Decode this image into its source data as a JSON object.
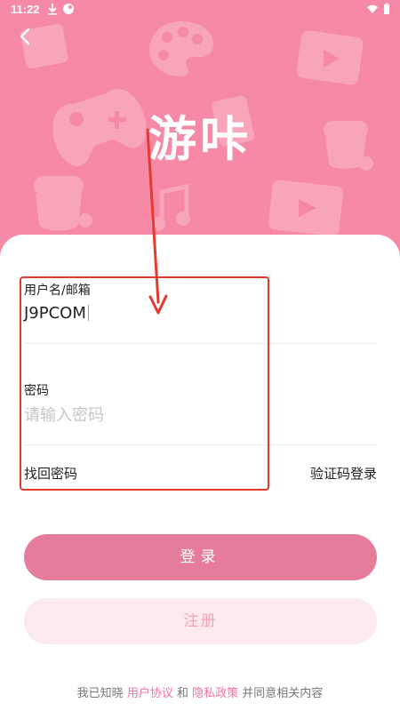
{
  "status_bar": {
    "time": "11:22",
    "icons": [
      "download-icon",
      "app-notification-icon",
      "wifi-icon",
      "battery-icon"
    ]
  },
  "header": {
    "back_icon": "chevron-left-icon",
    "app_title": "游咔",
    "background_color": "#f68aa6",
    "decorations": [
      "game-controller-icon",
      "palette-icon",
      "music-note-icon",
      "video-player-icon",
      "acorn-icon",
      "photo-card-icon"
    ]
  },
  "form": {
    "username_label": "用户名/邮箱",
    "username_value": "J9PCOM",
    "password_label": "密码",
    "password_placeholder": "请输入密码",
    "forgot_password": "找回密码",
    "sms_login": "验证码登录"
  },
  "buttons": {
    "login": "登录",
    "register": "注册"
  },
  "footer": {
    "prefix": "我已知晓",
    "user_agreement": "用户协议",
    "and": "和",
    "privacy_policy": "隐私政策",
    "suffix": "并同意相关内容"
  },
  "colors": {
    "accent": "#f3739a",
    "login_button": "#e57c99",
    "register_button_bg": "#fdeaef",
    "annotation": "#e53b2e"
  }
}
